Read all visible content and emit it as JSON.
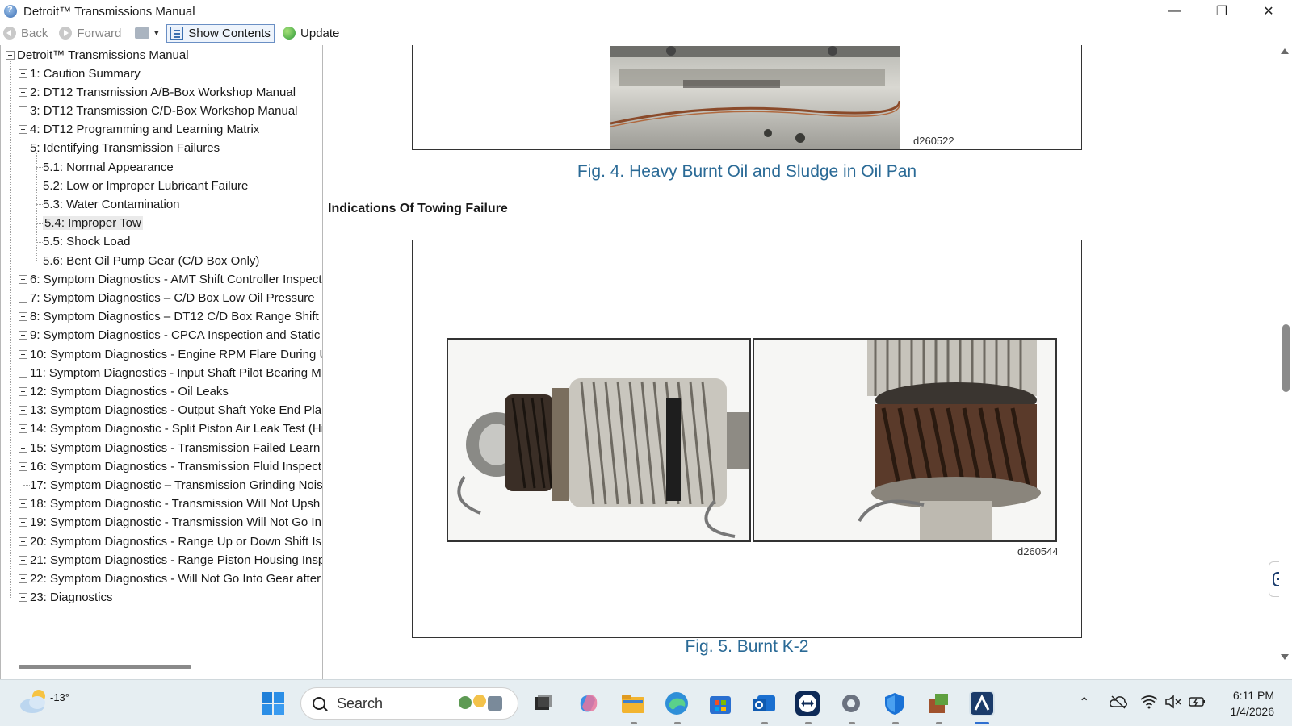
{
  "window": {
    "title": "Detroit™ Transmissions Manual",
    "minimize_label": "—",
    "restore_label": "❐",
    "close_label": "✕"
  },
  "toolbar": {
    "back_label": "Back",
    "forward_label": "Forward",
    "show_contents_label": "Show Contents",
    "update_label": "Update"
  },
  "tree": {
    "root": "Detroit™ Transmissions Manual",
    "items": [
      {
        "label": "1: Caution Summary",
        "expander": "plus"
      },
      {
        "label": "2: DT12 Transmission A/B-Box Workshop Manual",
        "expander": "plus"
      },
      {
        "label": "3: DT12 Transmission C/D-Box Workshop Manual",
        "expander": "plus"
      },
      {
        "label": "4: DT12 Programming and Learning Matrix",
        "expander": "plus"
      },
      {
        "label": "5: Identifying Transmission Failures",
        "expander": "minus"
      },
      {
        "label": "5.1: Normal Appearance",
        "expander": "none",
        "child": true
      },
      {
        "label": "5.2: Low or Improper Lubricant Failure",
        "expander": "none",
        "child": true
      },
      {
        "label": "5.3: Water Contamination",
        "expander": "none",
        "child": true
      },
      {
        "label": "5.4: Improper Tow",
        "expander": "none",
        "child": true,
        "selected": true
      },
      {
        "label": "5.5: Shock Load",
        "expander": "none",
        "child": true
      },
      {
        "label": "5.6: Bent Oil Pump Gear (C/D Box Only)",
        "expander": "none",
        "child": true
      },
      {
        "label": "6: Symptom Diagnostics - AMT Shift Controller Inspect",
        "expander": "plus"
      },
      {
        "label": "7: Symptom Diagnostics – C/D Box Low Oil Pressure",
        "expander": "plus"
      },
      {
        "label": "8: Symptom Diagnostics – DT12 C/D Box Range Shift t",
        "expander": "plus"
      },
      {
        "label": "9: Symptom Diagnostics - CPCA Inspection and Static",
        "expander": "plus"
      },
      {
        "label": "10: Symptom Diagnostics - Engine RPM Flare During U",
        "expander": "plus"
      },
      {
        "label": "11: Symptom Diagnostics - Input Shaft Pilot Bearing M",
        "expander": "plus"
      },
      {
        "label": "12: Symptom Diagnostics - Oil Leaks",
        "expander": "plus"
      },
      {
        "label": "13: Symptom Diagnostics - Output Shaft Yoke End Pla",
        "expander": "plus"
      },
      {
        "label": "14: Symptom Diagnostic - Split Piston Air Leak Test (Hi",
        "expander": "plus"
      },
      {
        "label": "15: Symptom Diagnostics - Transmission Failed Learn F",
        "expander": "plus"
      },
      {
        "label": "16: Symptom Diagnostics - Transmission Fluid Inspecti",
        "expander": "plus"
      },
      {
        "label": "17: Symptom Diagnostic – Transmission Grinding Nois",
        "expander": "none"
      },
      {
        "label": "18: Symptom Diagnostic - Transmission Will Not Upsh",
        "expander": "plus"
      },
      {
        "label": "19: Symptom Diagnostic - Transmission Will Not Go In",
        "expander": "plus"
      },
      {
        "label": "20: Symptom Diagnostics - Range Up or Down Shift Is",
        "expander": "plus"
      },
      {
        "label": "21: Symptom Diagnostics - Range Piston Housing Insp",
        "expander": "plus"
      },
      {
        "label": "22: Symptom Diagnostics - Will Not Go Into Gear after",
        "expander": "plus"
      },
      {
        "label": "23: Diagnostics",
        "expander": "plus"
      }
    ]
  },
  "content": {
    "fig4_id": "d260522",
    "fig4_caption": "Fig. 4. Heavy Burnt Oil and Sludge in Oil Pan",
    "section_heading": "Indications Of Towing Failure",
    "fig5_id": "d260544",
    "fig5_caption": "Fig. 5. Burnt K-2"
  },
  "taskbar": {
    "temperature": "-13°",
    "search_placeholder": "Search",
    "time": "6:11 PM",
    "date": "1/4/2026"
  },
  "colors": {
    "caption": "#2a6a96",
    "accent": "#2f6fd0"
  }
}
